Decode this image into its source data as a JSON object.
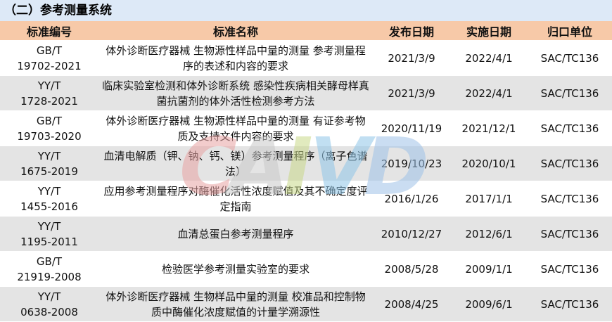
{
  "section_title": "（二）参考测量系统",
  "table": {
    "headers": [
      "标准编号",
      "标准名称",
      "发布日期",
      "实施日期",
      "归口单位"
    ],
    "rows": [
      {
        "id": "GB/T\n19702-2021",
        "name": "体外诊断医疗器械 生物源性样品中量的测量 参考测量程序的表述和内容的要求",
        "publish": "2021/3/9",
        "implement": "2022/4/1",
        "unit": "SAC/TC136"
      },
      {
        "id": "YY/T\n1728-2021",
        "name": "临床实验室检测和体外诊断系统 感染性疾病相关酵母样真菌抗菌剂的体外活性检测参考方法",
        "publish": "2021/3/9",
        "implement": "2022/4/1",
        "unit": "SAC/TC136"
      },
      {
        "id": "GB/T\n19703-2020",
        "name": "体外诊断医疗器械 生物源性样品中量的测量 有证参考物质及支持文件内容的要求",
        "publish": "2020/11/19",
        "implement": "2021/12/1",
        "unit": "SAC/TC136"
      },
      {
        "id": "YY/T\n1675-2019",
        "name": "血清电解质（钾、钠、钙、镁）参考测量程序（离子色谱法）",
        "publish": "2019/10/23",
        "implement": "2020/10/1",
        "unit": "SAC/TC136"
      },
      {
        "id": "YY/T\n1455-2016",
        "name": "应用参考测量程序对酶催化活性浓度赋值及其不确定度评定指南",
        "publish": "2016/1/26",
        "implement": "2017/1/1",
        "unit": "SAC/TC136"
      },
      {
        "id": "YY/T\n1195-2011",
        "name": "血清总蛋白参考测量程序",
        "publish": "2010/12/27",
        "implement": "2012/6/1",
        "unit": "SAC/TC136"
      },
      {
        "id": "GB/T\n21919-2008",
        "name": "检验医学参考测量实验室的要求",
        "publish": "2008/5/28",
        "implement": "2009/1/1",
        "unit": "SAC/TC136"
      },
      {
        "id": "YY/T\n0638-2008",
        "name": "体外诊断医疗器械 生物样品中量的测量 校准品和控制物质中酶催化浓度赋值的计量学溯源性",
        "publish": "2008/4/25",
        "implement": "2009/6/1",
        "unit": "SAC/TC136"
      }
    ]
  },
  "watermark": {
    "text": "CAIVD",
    "colors": [
      "#e9a3a3",
      "#c9c9c9",
      "#c9d98a",
      "#8fc6e8",
      "#9fc3e8"
    ]
  },
  "colors": {
    "title_bg": "#dde9f7",
    "header_bg": "#f7c9a8",
    "row_odd_bg": "#ffffff",
    "row_even_bg": "#e4e4e4"
  }
}
